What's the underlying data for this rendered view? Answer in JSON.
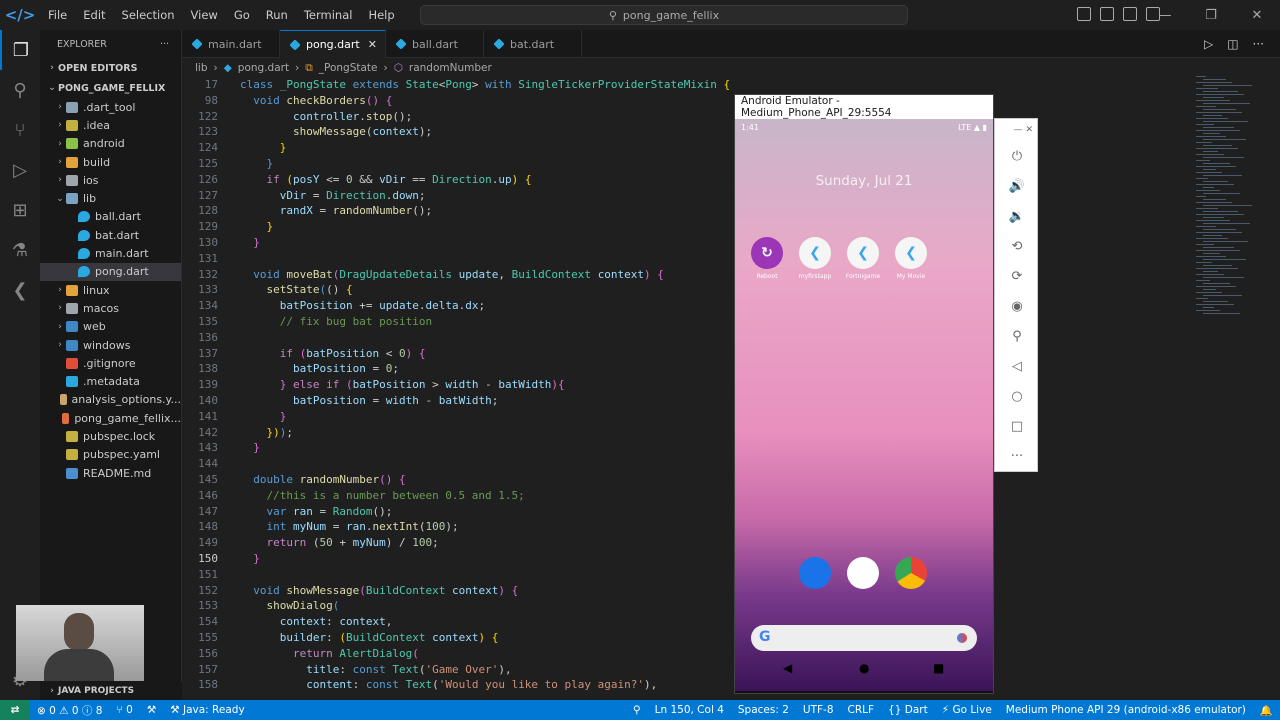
{
  "titlebar": {
    "menus": [
      "File",
      "Edit",
      "Selection",
      "View",
      "Go",
      "Run",
      "Terminal",
      "Help"
    ],
    "search": "pong_game_fellix"
  },
  "sidebar": {
    "title": "EXPLORER",
    "open_editors": "OPEN EDITORS",
    "project": "PONG_GAME_FELLIX",
    "items": [
      {
        "label": ".dart_tool",
        "indent": 1,
        "type": "folder",
        "color": "#8aa1b5"
      },
      {
        "label": ".idea",
        "indent": 1,
        "type": "folder",
        "color": "#c4b040"
      },
      {
        "label": "android",
        "indent": 1,
        "type": "folder",
        "color": "#8bc34a"
      },
      {
        "label": "build",
        "indent": 1,
        "type": "folder",
        "color": "#e2a33b"
      },
      {
        "label": "ios",
        "indent": 1,
        "type": "folder",
        "color": "#9ea5ad"
      },
      {
        "label": "lib",
        "indent": 1,
        "type": "folder-open",
        "color": "#7aa3c4"
      },
      {
        "label": "ball.dart",
        "indent": 2,
        "type": "dart",
        "color": "#2ba8e0"
      },
      {
        "label": "bat.dart",
        "indent": 2,
        "type": "dart",
        "color": "#2ba8e0"
      },
      {
        "label": "main.dart",
        "indent": 2,
        "type": "dart",
        "color": "#2ba8e0"
      },
      {
        "label": "pong.dart",
        "indent": 2,
        "type": "dart",
        "color": "#2ba8e0",
        "selected": true
      },
      {
        "label": "linux",
        "indent": 1,
        "type": "folder",
        "color": "#e2a33b"
      },
      {
        "label": "macos",
        "indent": 1,
        "type": "folder",
        "color": "#9ea5ad"
      },
      {
        "label": "web",
        "indent": 1,
        "type": "folder",
        "color": "#3f88c5"
      },
      {
        "label": "windows",
        "indent": 1,
        "type": "folder",
        "color": "#3f88c5"
      },
      {
        "label": ".gitignore",
        "indent": 1,
        "type": "file",
        "color": "#e04e39"
      },
      {
        "label": ".metadata",
        "indent": 1,
        "type": "file",
        "color": "#2ba8e0"
      },
      {
        "label": "analysis_options.y...",
        "indent": 1,
        "type": "file",
        "color": "#c9a46b"
      },
      {
        "label": "pong_game_fellix...",
        "indent": 1,
        "type": "file",
        "color": "#e36b3c"
      },
      {
        "label": "pubspec.lock",
        "indent": 1,
        "type": "file",
        "color": "#c4b040"
      },
      {
        "label": "pubspec.yaml",
        "indent": 1,
        "type": "file",
        "color": "#c4b040"
      },
      {
        "label": "README.md",
        "indent": 1,
        "type": "file",
        "color": "#4b8fd0"
      }
    ],
    "java_projects": "JAVA PROJECTS"
  },
  "tabs": [
    {
      "label": "main.dart",
      "active": false
    },
    {
      "label": "pong.dart",
      "active": true
    },
    {
      "label": "ball.dart",
      "active": false
    },
    {
      "label": "bat.dart",
      "active": false
    }
  ],
  "breadcrumb": [
    "lib",
    "pong.dart",
    "_PongState",
    "randomNumber"
  ],
  "code": [
    {
      "n": "17",
      "h": "<span class='k'>class</span> <span class='t'>_PongState</span> <span class='k'>extends</span> <span class='t'>State</span>&lt;<span class='t'>Pong</span>&gt; <span class='k'>with</span> <span class='t'>SingleTickerProviderStateMixin</span> <span class='y'>{</span>"
    },
    {
      "n": "98",
      "h": "  <span class='k'>void</span> <span class='f'>checkBorders</span><span class='p'>()</span> <span class='p'>{</span>"
    },
    {
      "n": "122",
      "h": "        <span class='v'>controller</span>.<span class='f'>stop</span>();"
    },
    {
      "n": "123",
      "h": "        <span class='f'>showMessage</span>(<span class='v'>context</span>);"
    },
    {
      "n": "124",
      "h": "      <span class='y'>}</span>"
    },
    {
      "n": "125",
      "h": "    <span class='k'>}</span>"
    },
    {
      "n": "126",
      "h": "    <span class='c'>if</span> <span class='y'>(</span><span class='v'>posY</span> &lt;= <span class='n'>0</span> &amp;&amp; <span class='v'>vDir</span> == <span class='t'>Direction</span>.<span class='v'>up</span><span class='y'>)</span> <span class='y'>{</span>"
    },
    {
      "n": "127",
      "h": "      <span class='v'>vDir</span> = <span class='t'>Direction</span>.<span class='v'>down</span>;"
    },
    {
      "n": "128",
      "h": "      <span class='v'>randX</span> = <span class='f'>randomNumber</span>();"
    },
    {
      "n": "129",
      "h": "    <span class='y'>}</span>"
    },
    {
      "n": "130",
      "h": "  <span class='p'>}</span>"
    },
    {
      "n": "131",
      "h": ""
    },
    {
      "n": "132",
      "h": "  <span class='k'>void</span> <span class='f'>moveBat</span><span class='p'>(</span><span class='t'>DragUpdateDetails</span> <span class='v'>update</span>, <span class='t'>BuildContext</span> <span class='v'>context</span><span class='p'>)</span> <span class='p'>{</span>"
    },
    {
      "n": "133",
      "h": "    <span class='f'>setState</span><span class='k'>(</span>() <span class='y'>{</span>"
    },
    {
      "n": "134",
      "h": "      <span class='v'>batPosition</span> += <span class='v'>update</span>.<span class='v'>delta</span>.<span class='v'>dx</span>;"
    },
    {
      "n": "135",
      "h": "      <span class='cm'>// fix bug bat position</span>"
    },
    {
      "n": "136",
      "h": ""
    },
    {
      "n": "137",
      "h": "      <span class='c'>if</span> <span class='p'>(</span><span class='v'>batPosition</span> &lt; <span class='n'>0</span><span class='p'>)</span> <span class='p'>{</span>"
    },
    {
      "n": "138",
      "h": "        <span class='v'>batPosition</span> = <span class='n'>0</span>;"
    },
    {
      "n": "139",
      "h": "      <span class='p'>}</span> <span class='c'>else</span> <span class='c'>if</span> <span class='p'>(</span><span class='v'>batPosition</span> &gt; <span class='v'>width</span> - <span class='v'>batWidth</span><span class='p'>){</span>"
    },
    {
      "n": "140",
      "h": "        <span class='v'>batPosition</span> = <span class='v'>width</span> - <span class='v'>batWidth</span>;"
    },
    {
      "n": "141",
      "h": "      <span class='p'>}</span>"
    },
    {
      "n": "142",
      "h": "    <span class='y'>})</span><span class='k'>)</span>;"
    },
    {
      "n": "143",
      "h": "  <span class='p'>}</span>"
    },
    {
      "n": "144",
      "h": ""
    },
    {
      "n": "145",
      "h": "  <span class='k'>double</span> <span class='f'>randomNumber</span><span class='p'>()</span> <span class='p'>{</span>"
    },
    {
      "n": "146",
      "h": "    <span class='cm'>//this is a number between 0.5 and 1.5;</span>"
    },
    {
      "n": "147",
      "h": "    <span class='k'>var</span> <span class='v'>ran</span> = <span class='t'>Random</span>();"
    },
    {
      "n": "148",
      "h": "    <span class='k'>int</span> <span class='v'>myNum</span> = <span class='v'>ran</span>.<span class='f'>nextInt</span>(<span class='n'>100</span>);"
    },
    {
      "n": "149",
      "h": "    <span class='c'>return</span> (<span class='n'>50</span> + <span class='v'>myNum</span>) / <span class='n'>100</span>;"
    },
    {
      "n": "150",
      "h": "  <span class='p'>}</span>",
      "current": true
    },
    {
      "n": "151",
      "h": ""
    },
    {
      "n": "152",
      "h": "  <span class='k'>void</span> <span class='f'>showMessage</span><span class='p'>(</span><span class='t'>BuildContext</span> <span class='v'>context</span><span class='p'>)</span> <span class='p'>{</span>"
    },
    {
      "n": "153",
      "h": "    <span class='f'>showDialog</span><span class='k'>(</span>"
    },
    {
      "n": "154",
      "h": "      <span class='v'>context</span>: <span class='v'>context</span>,"
    },
    {
      "n": "155",
      "h": "      <span class='v'>builder</span>: <span class='y'>(</span><span class='t'>BuildContext</span> <span class='v'>context</span><span class='y'>)</span> <span class='y'>{</span>"
    },
    {
      "n": "156",
      "h": "        <span class='c'>return</span> <span class='t'>AlertDialog</span><span class='p'>(</span>"
    },
    {
      "n": "157",
      "h": "          <span class='v'>title</span>: <span class='k'>const</span> <span class='t'>Text</span>(<span class='s'>'Game Over'</span>),"
    },
    {
      "n": "158",
      "h": "          <span class='v'>content</span>: <span class='k'>const</span> <span class='t'>Text</span>(<span class='s'>'Would you like to play again?'</span>),"
    }
  ],
  "emulator": {
    "title": "Android Emulator - Medium_Phone_API_29:5554",
    "time": "1:41",
    "status_right": "LTE ▲ ▮",
    "date": "Sunday, Jul 21",
    "apps": [
      "Reboot",
      "myfirstapp",
      "Fortnigame",
      "My Movie"
    ]
  },
  "statusbar": {
    "errors": "0",
    "warnings": "0",
    "info": "8",
    "ports": "0",
    "java": "Java: Ready",
    "position": "Ln 150, Col 4",
    "spaces": "Spaces: 2",
    "encoding": "UTF-8",
    "eol": "CRLF",
    "language": "Dart",
    "golive": "Go Live",
    "device": "Medium Phone API 29 (android-x86 emulator)"
  }
}
